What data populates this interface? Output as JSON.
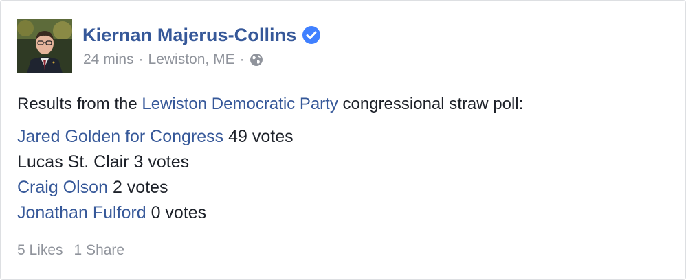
{
  "post": {
    "author": "Kiernan Majerus-Collins",
    "time": "24 mins",
    "separator": "·",
    "location": "Lewiston, ME",
    "audience_icon": "globe-icon",
    "verified_icon": "verified-badge-icon",
    "text_before": "Results from the ",
    "text_link": "Lewiston Democratic Party",
    "text_after": " congressional straw poll:",
    "results": [
      {
        "name": "Jared Golden for Congress",
        "votes": " 49 votes",
        "is_link": true
      },
      {
        "name": "Lucas St. Clair",
        "votes": " 3 votes",
        "is_link": false
      },
      {
        "name": "Craig Olson",
        "votes": " 2 votes",
        "is_link": true
      },
      {
        "name": "Jonathan Fulford",
        "votes": " 0 votes",
        "is_link": true
      }
    ],
    "likes": "5 Likes",
    "shares": "1 Share"
  },
  "colors": {
    "link": "#365899",
    "text": "#1d2129",
    "meta": "#90949c",
    "verified": "#4080ff"
  }
}
